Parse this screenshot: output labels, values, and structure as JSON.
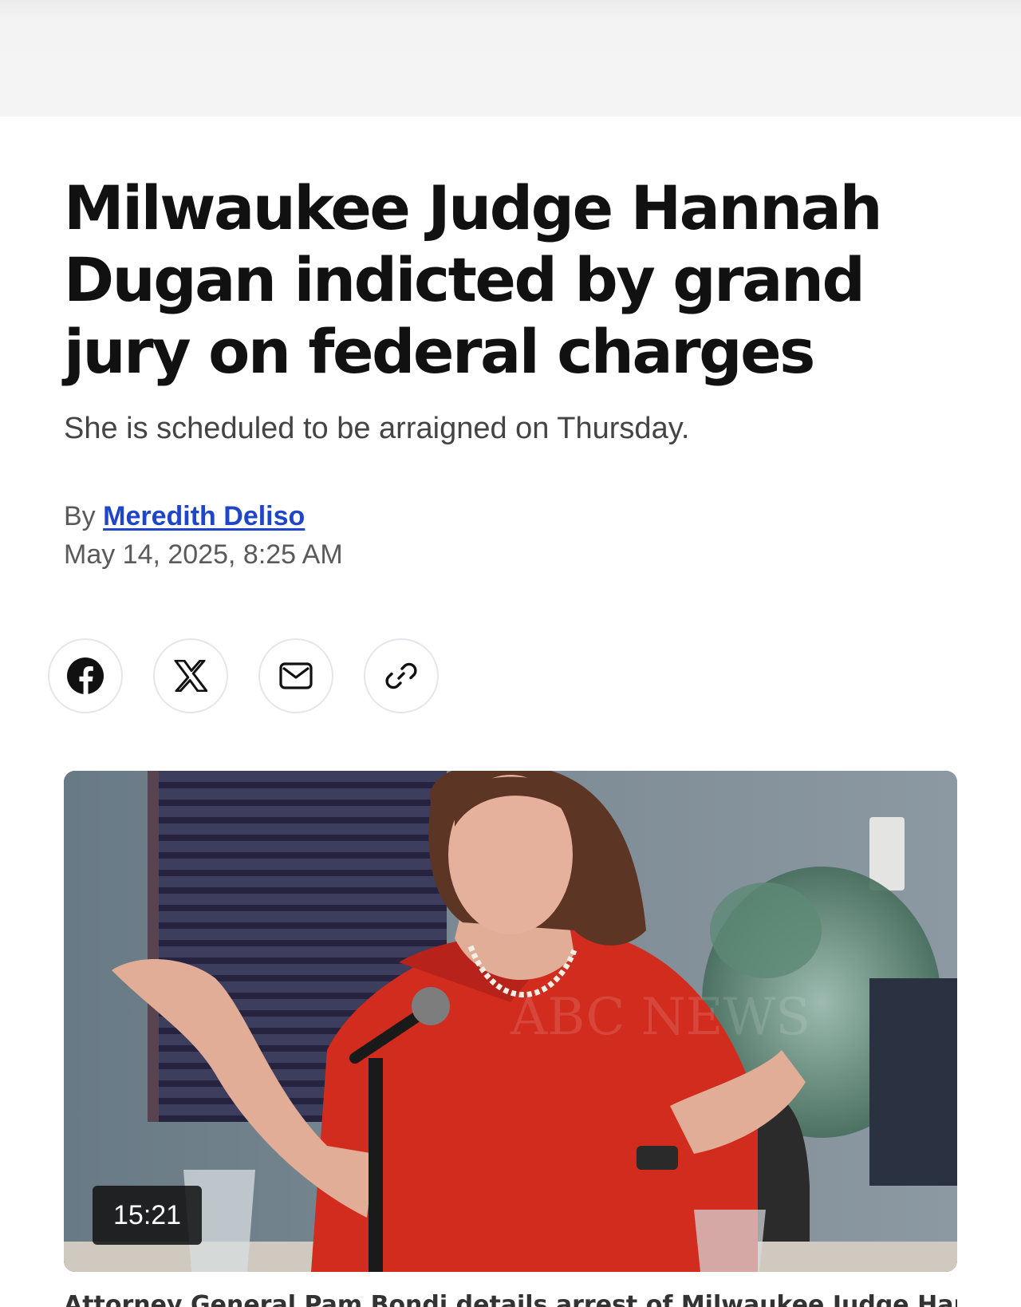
{
  "article": {
    "headline": "Milwaukee Judge Hannah Dugan indicted by grand jury on federal charges",
    "subheadline": "She is scheduled to be arraigned on Thursday.",
    "byline_prefix": "By",
    "author": "Meredith Deliso",
    "timestamp": "May 14, 2025, 8:25 AM"
  },
  "share": {
    "buttons": [
      {
        "icon": "facebook-icon"
      },
      {
        "icon": "x-icon"
      },
      {
        "icon": "mail-icon"
      },
      {
        "icon": "link-icon"
      }
    ]
  },
  "media": {
    "duration": "15:21",
    "watermark": "ABC NEWS"
  },
  "caption": {
    "text": "Attorney General Pam Bondi details arrest of Milwaukee Judge Hannah"
  },
  "colors": {
    "link": "#1f45c8",
    "top_band": "#f4f4f5",
    "share_border": "#e6e6ea"
  }
}
